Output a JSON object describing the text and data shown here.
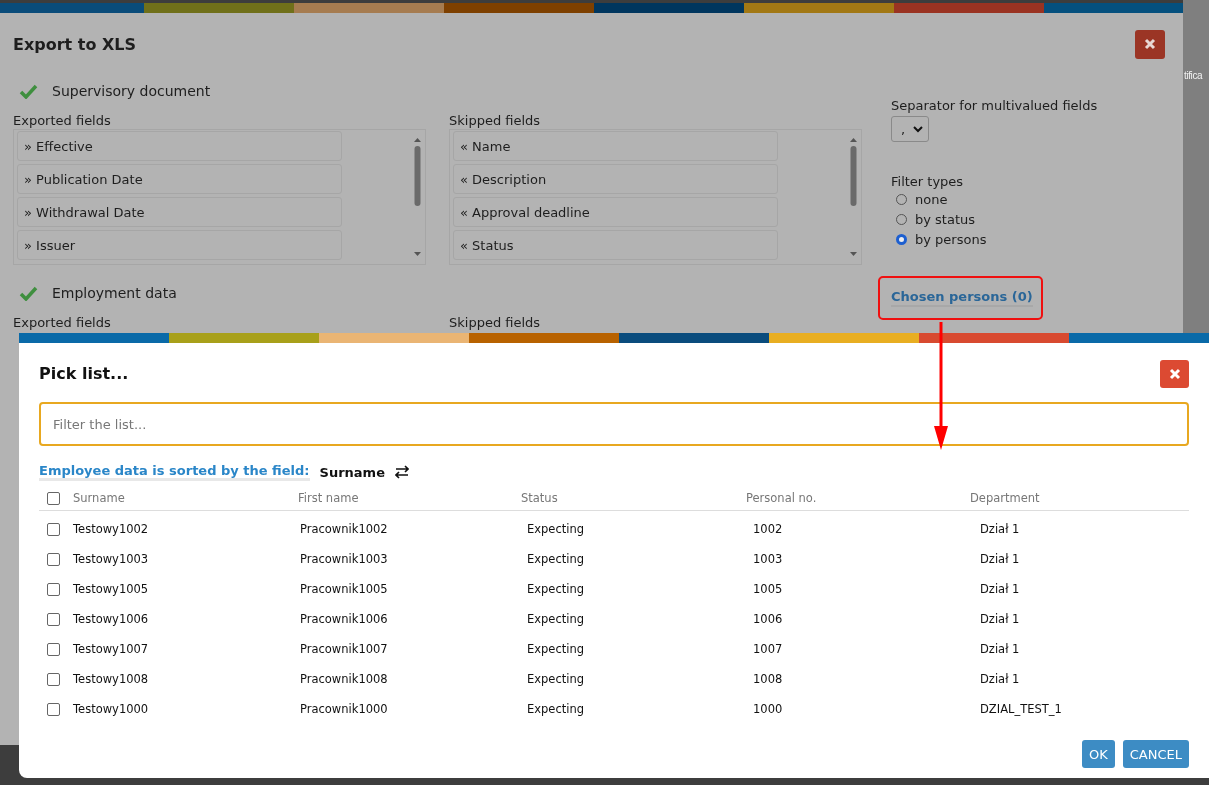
{
  "background_page": {
    "text": "tifica"
  },
  "export_dialog": {
    "title": "Export to XLS",
    "sections": [
      {
        "title": "Supervisory document",
        "checked": true,
        "exported_label": "Exported fields",
        "exported_fields": [
          "» Effective",
          "» Publication Date",
          "» Withdrawal Date",
          "» Issuer"
        ],
        "skipped_label": "Skipped fields",
        "skipped_fields": [
          "« Name",
          "« Description",
          "« Approval deadline",
          "« Status"
        ]
      },
      {
        "title": "Employment data",
        "checked": true,
        "exported_label": "Exported fields",
        "skipped_label": "Skipped fields"
      }
    ],
    "separator": {
      "label": "Separator for multivalued fields",
      "value": ","
    },
    "filter_types": {
      "label": "Filter types",
      "options": [
        {
          "label": "none",
          "selected": false
        },
        {
          "label": "by status",
          "selected": false
        },
        {
          "label": "by persons",
          "selected": true
        }
      ]
    },
    "chosen_persons": "Chosen persons (0)"
  },
  "pick_list": {
    "title": "Pick list...",
    "filter_placeholder": "Filter the list...",
    "sort_label": "Employee data is sorted by the field:",
    "sort_field": "Surname",
    "select_all": false,
    "columns": [
      "Surname",
      "First name",
      "Status",
      "Personal no.",
      "Department"
    ],
    "rows": [
      {
        "selected": false,
        "cells": [
          "Testowy1002",
          "Pracownik1002",
          "Expecting",
          "1002",
          "Dział 1"
        ]
      },
      {
        "selected": false,
        "cells": [
          "Testowy1003",
          "Pracownik1003",
          "Expecting",
          "1003",
          "Dział 1"
        ]
      },
      {
        "selected": false,
        "cells": [
          "Testowy1005",
          "Pracownik1005",
          "Expecting",
          "1005",
          "Dział 1"
        ]
      },
      {
        "selected": false,
        "cells": [
          "Testowy1006",
          "Pracownik1006",
          "Expecting",
          "1006",
          "Dział 1"
        ]
      },
      {
        "selected": false,
        "cells": [
          "Testowy1007",
          "Pracownik1007",
          "Expecting",
          "1007",
          "Dział 1"
        ]
      },
      {
        "selected": false,
        "cells": [
          "Testowy1008",
          "Pracownik1008",
          "Expecting",
          "1008",
          "Dział 1"
        ]
      },
      {
        "selected": false,
        "cells": [
          "Testowy1000",
          "Pracownik1000",
          "Expecting",
          "1000",
          "DZIAL_TEST_1"
        ]
      }
    ],
    "buttons": [
      "OK",
      "CANCEL"
    ]
  }
}
